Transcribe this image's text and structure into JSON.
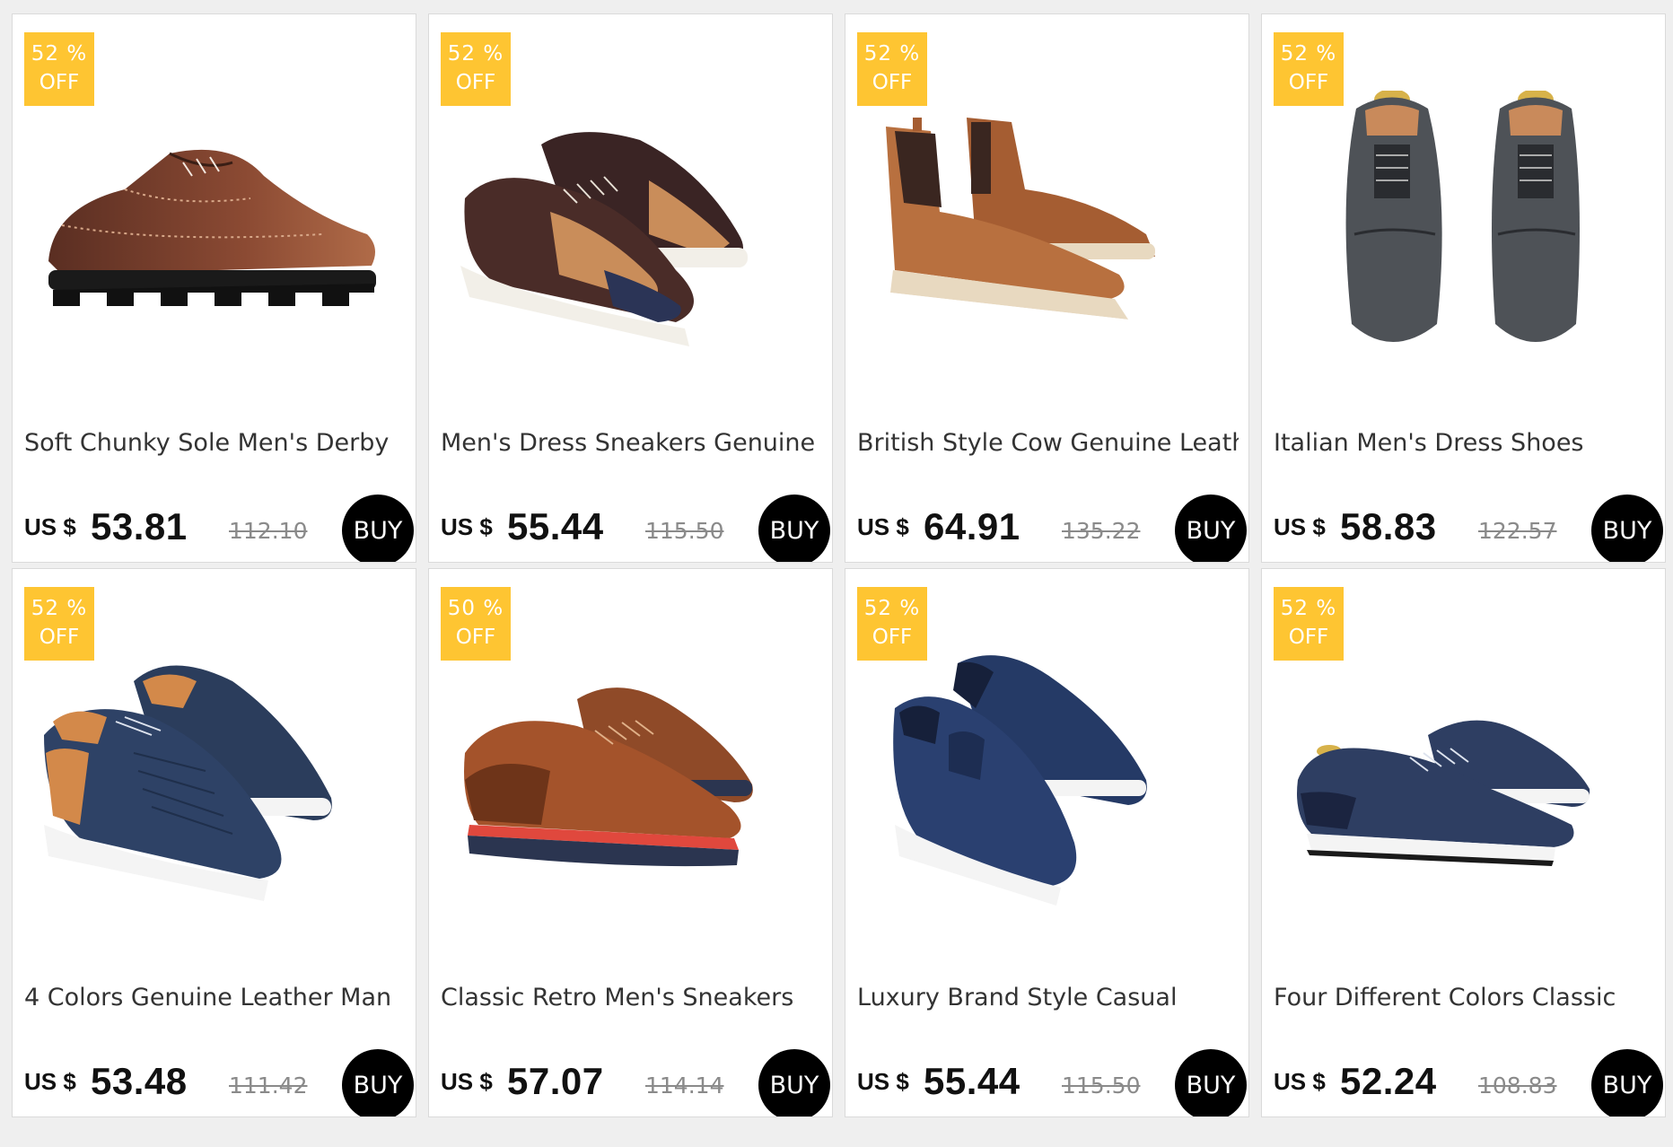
{
  "products": [
    {
      "badge_pct": "52 %",
      "badge_off": "OFF",
      "title": "Soft Chunky Sole Men's Derby",
      "currency": "US $",
      "price": "53.81",
      "old_price": "112.10",
      "buy_label": "BUY",
      "image": "brown-derby-shoe",
      "colors": {
        "upper": "#6b3a2a",
        "accent": "#a15c3d",
        "sole": "#1a1a1a"
      }
    },
    {
      "badge_pct": "52 %",
      "badge_off": "OFF",
      "title": "Men's Dress Sneakers Genuine",
      "currency": "US $",
      "price": "55.44",
      "old_price": "115.50",
      "buy_label": "BUY",
      "image": "two-tone-brogue-sneakers",
      "colors": {
        "upper": "#3d2a2a",
        "accent": "#c98d5a",
        "sole": "#f2efe8"
      }
    },
    {
      "badge_pct": "52 %",
      "badge_off": "OFF",
      "title": "British Style Cow Genuine Leather",
      "currency": "US $",
      "price": "64.91",
      "old_price": "135.22",
      "buy_label": "BUY",
      "image": "tan-chelsea-boots",
      "colors": {
        "upper": "#b5693a",
        "accent": "#3a2620",
        "sole": "#e8d9c0"
      }
    },
    {
      "badge_pct": "52 %",
      "badge_off": "OFF",
      "title": "Italian Men's Dress Shoes",
      "currency": "US $",
      "price": "58.83",
      "old_price": "122.57",
      "buy_label": "BUY",
      "image": "grey-oxford-shoes",
      "colors": {
        "upper": "#4e5257",
        "accent": "#2a2c30",
        "sole": "#1a1a1a"
      }
    },
    {
      "badge_pct": "52 %",
      "badge_off": "OFF",
      "title": "4 Colors Genuine Leather Man",
      "currency": "US $",
      "price": "53.48",
      "old_price": "111.42",
      "buy_label": "BUY",
      "image": "navy-woven-sneakers",
      "colors": {
        "upper": "#2b3d5c",
        "accent": "#d3894a",
        "sole": "#f4f4f4"
      }
    },
    {
      "badge_pct": "50 %",
      "badge_off": "OFF",
      "title": "Classic Retro Men's Sneakers",
      "currency": "US $",
      "price": "57.07",
      "old_price": "114.14",
      "buy_label": "BUY",
      "image": "brown-retro-sneakers",
      "colors": {
        "upper": "#a4532b",
        "accent": "#e0483d",
        "sole": "#2b3550"
      }
    },
    {
      "badge_pct": "52 %",
      "badge_off": "OFF",
      "title": "Luxury Brand Style Casual",
      "currency": "US $",
      "price": "55.44",
      "old_price": "115.50",
      "buy_label": "BUY",
      "image": "navy-slip-on-sneakers",
      "colors": {
        "upper": "#253a66",
        "accent": "#16203a",
        "sole": "#f4f4f4"
      }
    },
    {
      "badge_pct": "52 %",
      "badge_off": "OFF",
      "title": "Four Different Colors Classic",
      "currency": "US $",
      "price": "52.24",
      "old_price": "108.83",
      "buy_label": "BUY",
      "image": "navy-perforated-sneakers",
      "colors": {
        "upper": "#2e3e62",
        "accent": "#1b2440",
        "sole": "#f4f4f4"
      }
    }
  ],
  "colors": {
    "badge": "#fec532",
    "buy_button": "#000000",
    "page_bg": "#efefef"
  }
}
